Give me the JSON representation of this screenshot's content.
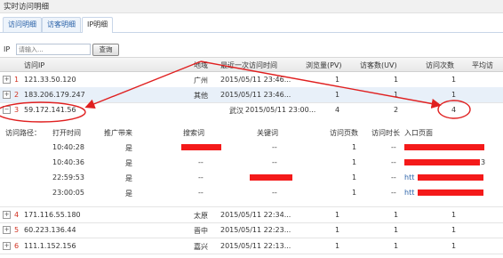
{
  "window": {
    "title": "实时访问明细"
  },
  "tabs": [
    {
      "label": "访问明细",
      "active": false
    },
    {
      "label": "访客明细",
      "active": false
    },
    {
      "label": "IP明细",
      "active": true
    }
  ],
  "search": {
    "label": "IP",
    "placeholder": "请输入...",
    "button": "查询"
  },
  "table": {
    "headers": [
      "访问IP",
      "地域",
      "最近一次访问时间",
      "浏览量(PV)",
      "访客数(UV)",
      "访问次数",
      "平均访"
    ],
    "rows": [
      {
        "idx": "1",
        "ip": "121.33.50.120",
        "region": "广州",
        "time": "2015/05/11 23:46...",
        "pv": "1",
        "uv": "1",
        "visits": "1",
        "expand": "+"
      },
      {
        "idx": "2",
        "ip": "183.206.179.247",
        "region": "其他",
        "time": "2015/05/11 23:46...",
        "pv": "1",
        "uv": "1",
        "visits": "1",
        "expand": "+"
      },
      {
        "idx": "3",
        "ip": "59.172.141.56",
        "region": "武汉",
        "time": "2015/05/11 23:00...",
        "pv": "4",
        "uv": "2",
        "visits": "4",
        "expand": "−"
      }
    ],
    "rows_after": [
      {
        "idx": "4",
        "ip": "171.116.55.180",
        "region": "太原",
        "time": "2015/05/11 22:34...",
        "pv": "1",
        "uv": "1",
        "visits": "1",
        "expand": "+"
      },
      {
        "idx": "5",
        "ip": "60.223.136.44",
        "region": "晋中",
        "time": "2015/05/11 22:23...",
        "pv": "1",
        "uv": "1",
        "visits": "1",
        "expand": "+"
      },
      {
        "idx": "6",
        "ip": "111.1.152.156",
        "region": "嘉兴",
        "time": "2015/05/11 22:13...",
        "pv": "1",
        "uv": "1",
        "visits": "1",
        "expand": "+"
      }
    ]
  },
  "path": {
    "label": "访问路径：",
    "headers": [
      "打开时间",
      "推广带来",
      "搜索词",
      "关键词",
      "访问页数",
      "访问时长",
      "入口页面"
    ],
    "rows": [
      {
        "time": "10:40:28",
        "promo": "是",
        "search": "",
        "keyword": "--",
        "pages": "1",
        "duration": "--",
        "entry": ""
      },
      {
        "time": "10:40:36",
        "promo": "是",
        "search": "--",
        "keyword": "--",
        "pages": "1",
        "duration": "--",
        "entry": "3"
      },
      {
        "time": "22:59:53",
        "promo": "是",
        "search": "--",
        "keyword": "",
        "pages": "1",
        "duration": "--",
        "entry": "htt"
      },
      {
        "time": "23:00:05",
        "promo": "是",
        "search": "--",
        "keyword": "--",
        "pages": "1",
        "duration": "--",
        "entry": "htt"
      }
    ]
  },
  "annotations": {
    "highlight_color": "#e02020",
    "redaction_color": "#f41a1a"
  }
}
